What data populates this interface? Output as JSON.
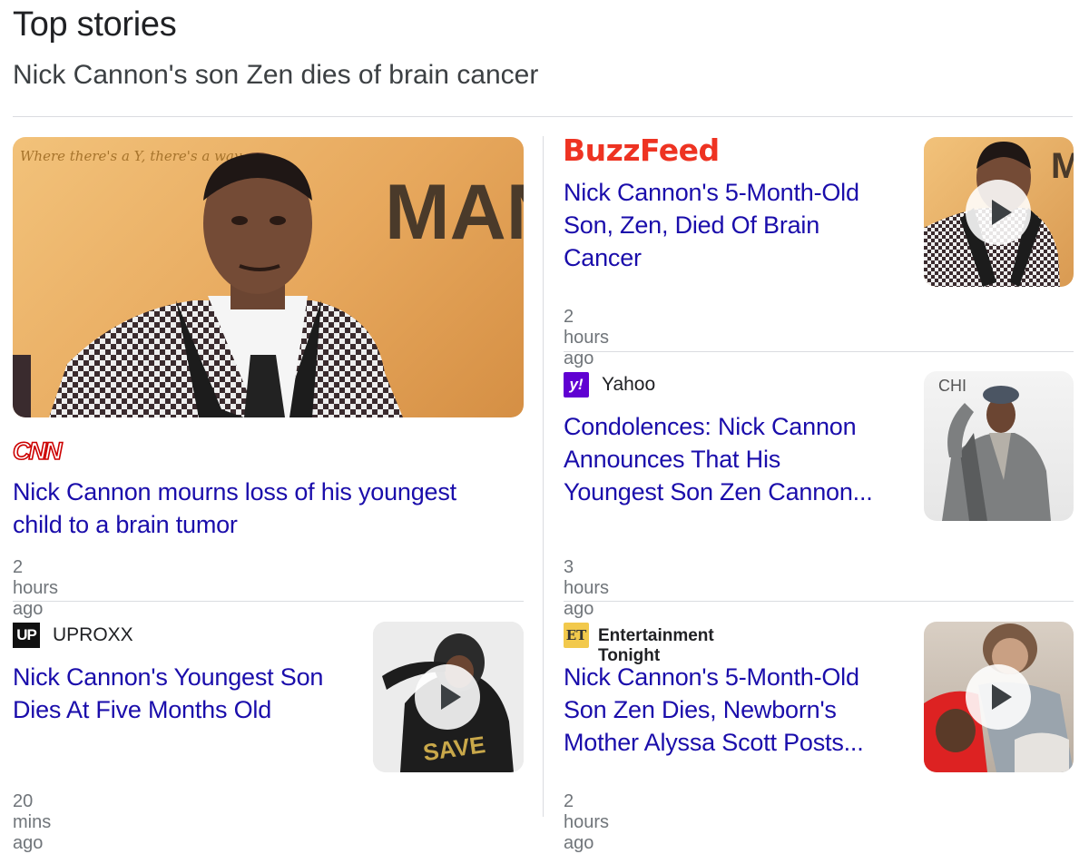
{
  "header": {
    "title": "Top stories",
    "subtitle": "Nick Cannon's son Zen dies of brain cancer"
  },
  "stories": [
    {
      "source": "CNN",
      "logo_text": "CNN",
      "headline_line1": "Nick Cannon mourns loss of his youngest",
      "headline_line2": "child to a brain tumor",
      "time": "2 hours ago",
      "has_video": false
    },
    {
      "source": "BuzzFeed",
      "logo_text": "BuzzFeed",
      "headline_line1": "Nick Cannon's 5-Month-Old",
      "headline_line2": "Son, Zen, Died Of Brain",
      "headline_line3": "Cancer",
      "time": "2 hours ago",
      "has_video": true
    },
    {
      "source": "Yahoo",
      "logo_text": "y!",
      "headline_line1": "Condolences: Nick Cannon",
      "headline_line2": "Announces That His",
      "headline_line3": "Youngest Son Zen Cannon...",
      "time": "3 hours ago",
      "has_video": false
    },
    {
      "source": "UPROXX",
      "logo_text": "UP",
      "headline_line1": "Nick Cannon's Youngest Son",
      "headline_line2": "Dies At Five Months Old",
      "time": "20 mins ago",
      "has_video": true
    },
    {
      "source": "Entertainment Tonight",
      "logo_text": "ET",
      "headline_line1": "Nick Cannon's 5-Month-Old",
      "headline_line2": "Son Zen Dies, Newborn's",
      "headline_line3": "Mother Alyssa Scott Posts...",
      "time": "2 hours ago",
      "has_video": true
    }
  ],
  "images": {
    "hero_wall_text": "Where there's a Y, there's a way.",
    "hero_backdrop_text": "MAN",
    "buzzfeed_backdrop_text": "M",
    "yahoo_backdrop_text": "CHI",
    "uproxx_shirt_text": "SAVE"
  },
  "colors": {
    "link": "#1a0dab",
    "meta": "#70757a",
    "divider": "#dadce0",
    "cnn_red": "#cc0000",
    "buzzfeed_red": "#ee3322",
    "yahoo_purple": "#6001d2"
  }
}
